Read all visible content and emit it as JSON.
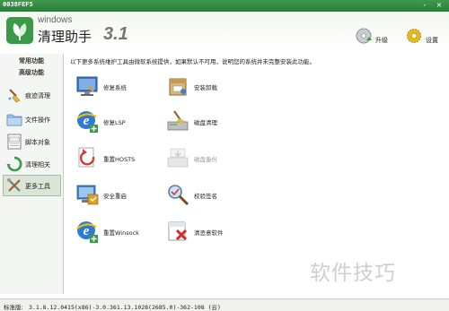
{
  "window": {
    "title": "0038FEF5",
    "controls": [
      "-",
      "×"
    ]
  },
  "header": {
    "logo_small": "windows",
    "logo_main": "清理助手",
    "logo_version": "3.1",
    "buttons": [
      {
        "label": "升级",
        "icon": "upgrade-disc-icon"
      },
      {
        "label": "设置",
        "icon": "settings-gear-icon"
      }
    ]
  },
  "sidebar": {
    "sections": [
      "常用功能",
      "高级功能"
    ],
    "items": [
      {
        "label": "痕迹清理",
        "icon": "broom-icon"
      },
      {
        "label": "文件操作",
        "icon": "folder-icon"
      },
      {
        "label": "脚本对象",
        "icon": "script-file-icon"
      },
      {
        "label": "清理相关",
        "icon": "refresh-arrows-icon"
      },
      {
        "label": "更多工具",
        "icon": "tools-icon",
        "active": true
      }
    ]
  },
  "main": {
    "intro": "以下更多系统维护工具由微软系统提供，如果默认不可用，说明您的系统并未完整安装此功能。",
    "tools": [
      {
        "label": "修复系统",
        "icon": "monitor-repair-icon",
        "enabled": true
      },
      {
        "label": "安装卸载",
        "icon": "install-box-icon",
        "enabled": true
      },
      {
        "label": "修复LSP",
        "icon": "ie-repair-icon",
        "enabled": true
      },
      {
        "label": "磁盘清理",
        "icon": "disk-cleanup-icon",
        "enabled": true
      },
      {
        "label": "重置HOSTS",
        "icon": "hosts-reset-icon",
        "enabled": true
      },
      {
        "label": "磁盘备份",
        "icon": "disk-backup-icon",
        "enabled": false
      },
      {
        "label": "安全重启",
        "icon": "safe-restart-icon",
        "enabled": true
      },
      {
        "label": "校验签名",
        "icon": "signature-check-icon",
        "enabled": true
      },
      {
        "label": "重置Winsock",
        "icon": "winsock-reset-icon",
        "enabled": true
      },
      {
        "label": "清恶意软件",
        "icon": "malware-remove-icon",
        "enabled": true
      }
    ]
  },
  "status": {
    "label": "标准版:",
    "text": "3.1.8.12.0415(x86)-3.0.361.13.1028(2685.0)-362-108 (云)"
  },
  "watermark": "软件技巧",
  "colors": {
    "titlebar": "#2a7d3a",
    "accent_green": "#3a9a48",
    "active_item": "#d9e5d5"
  }
}
